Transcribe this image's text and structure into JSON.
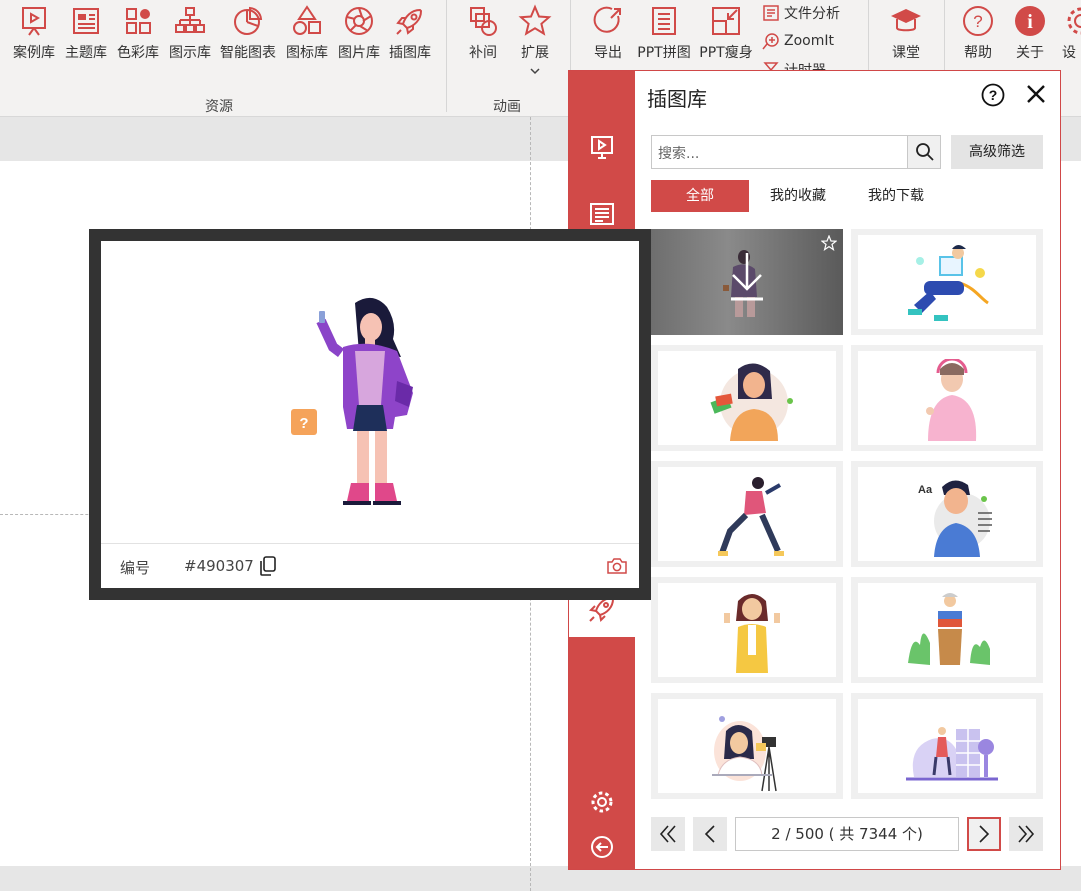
{
  "ribbon": {
    "buttons": [
      {
        "id": "cases",
        "label": "案例库"
      },
      {
        "id": "themes",
        "label": "主题库"
      },
      {
        "id": "colors",
        "label": "色彩库"
      },
      {
        "id": "diagrams",
        "label": "图示库"
      },
      {
        "id": "smartcharts",
        "label": "智能图表"
      },
      {
        "id": "icons",
        "label": "图标库"
      },
      {
        "id": "pictures",
        "label": "图片库"
      },
      {
        "id": "illustrations",
        "label": "插图库"
      },
      {
        "id": "tween",
        "label": "补间"
      },
      {
        "id": "extend",
        "label": "扩展"
      },
      {
        "id": "export",
        "label": "导出"
      },
      {
        "id": "collage",
        "label": "PPT拼图"
      },
      {
        "id": "slim",
        "label": "PPT瘦身"
      },
      {
        "id": "classroom",
        "label": "课堂"
      },
      {
        "id": "help",
        "label": "帮助"
      },
      {
        "id": "about",
        "label": "关于"
      },
      {
        "id": "settings",
        "label": "设"
      }
    ],
    "small": {
      "file_analysis": "文件分析",
      "zoomit": "ZoomIt",
      "timer": "计时器"
    },
    "groups": {
      "resources": "资源",
      "animation": "动画"
    }
  },
  "pane": {
    "title": "插图库",
    "search_placeholder": "搜索...",
    "advanced_filter": "高级筛选",
    "tabs": [
      {
        "label": "全部"
      },
      {
        "label": "我的收藏"
      },
      {
        "label": "我的下载"
      }
    ],
    "pager": {
      "info": "2  / 500 ( 共 7344 个)"
    }
  },
  "preview": {
    "id_label": "编号",
    "id_value": "#490307"
  },
  "colors": {
    "accent": "#d14a48",
    "ribbon_bg": "#f3f2f1"
  }
}
